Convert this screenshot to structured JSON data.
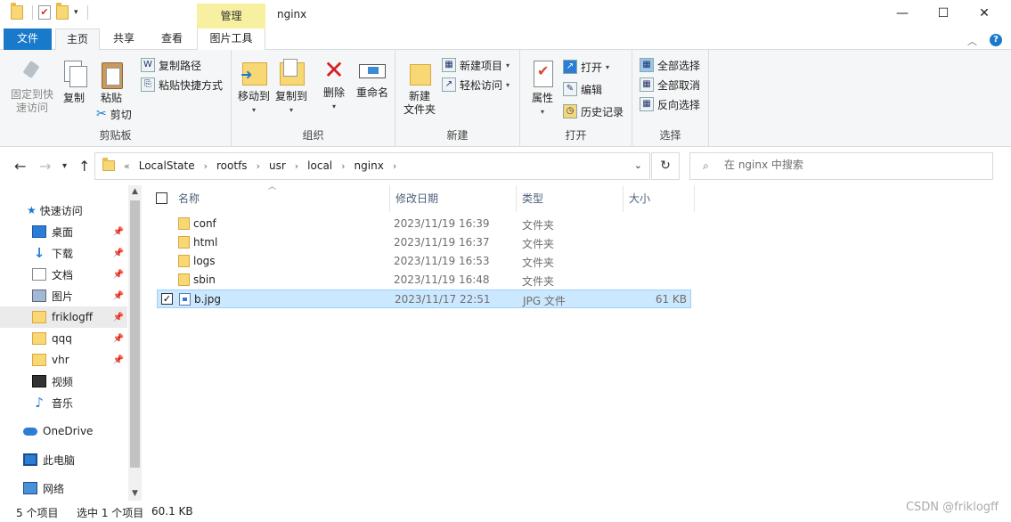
{
  "window": {
    "title": "nginx",
    "context_tab_group": "管理",
    "controls": {
      "minimize": "—",
      "maximize": "☐",
      "close": "✕"
    }
  },
  "ribbon_tabs": {
    "file": "文件",
    "home": "主页",
    "share": "共享",
    "view": "查看",
    "picture_tools": "图片工具"
  },
  "ribbon": {
    "clipboard": {
      "label": "剪贴板",
      "pin_quick_access_1": "固定到快",
      "pin_quick_access_2": "速访问",
      "copy": "复制",
      "paste": "粘贴",
      "copy_path": "复制路径",
      "paste_shortcut": "粘贴快捷方式",
      "cut": "剪切"
    },
    "organize": {
      "label": "组织",
      "move_to": "移动到",
      "copy_to": "复制到",
      "delete": "删除",
      "rename": "重命名"
    },
    "new": {
      "label": "新建",
      "new_folder_1": "新建",
      "new_folder_2": "文件夹",
      "new_item": "新建项目",
      "easy_access": "轻松访问"
    },
    "open": {
      "label": "打开",
      "properties": "属性",
      "open": "打开",
      "edit": "编辑",
      "history": "历史记录"
    },
    "select": {
      "label": "选择",
      "select_all": "全部选择",
      "select_none": "全部取消",
      "invert": "反向选择"
    }
  },
  "address": {
    "overflow": "«",
    "crumbs": [
      "LocalState",
      "rootfs",
      "usr",
      "local",
      "nginx"
    ],
    "separator": "›"
  },
  "search": {
    "placeholder": "在 nginx 中搜索"
  },
  "nav": {
    "quick_access": "快速访问",
    "items": [
      {
        "label": "桌面",
        "icon": "desktop-icon",
        "pinned": true
      },
      {
        "label": "下载",
        "icon": "download-icon",
        "pinned": true
      },
      {
        "label": "文档",
        "icon": "document-icon",
        "pinned": true
      },
      {
        "label": "图片",
        "icon": "picture-icon",
        "pinned": true
      },
      {
        "label": "friklogff",
        "icon": "folder-icon",
        "pinned": true,
        "selected": true
      },
      {
        "label": "qqq",
        "icon": "folder-icon",
        "pinned": true
      },
      {
        "label": "vhr",
        "icon": "folder-icon",
        "pinned": true
      },
      {
        "label": "视频",
        "icon": "video-icon",
        "pinned": false
      },
      {
        "label": "音乐",
        "icon": "music-icon",
        "pinned": false
      }
    ],
    "onedrive": "OneDrive",
    "this_pc": "此电脑",
    "network": "网络"
  },
  "columns": {
    "name": "名称",
    "date": "修改日期",
    "type": "类型",
    "size": "大小"
  },
  "files": [
    {
      "name": "conf",
      "date": "2023/11/19 16:39",
      "type": "文件夹",
      "size": "",
      "kind": "folder"
    },
    {
      "name": "html",
      "date": "2023/11/19 16:37",
      "type": "文件夹",
      "size": "",
      "kind": "folder"
    },
    {
      "name": "logs",
      "date": "2023/11/19 16:53",
      "type": "文件夹",
      "size": "",
      "kind": "folder"
    },
    {
      "name": "sbin",
      "date": "2023/11/19 16:48",
      "type": "文件夹",
      "size": "",
      "kind": "folder"
    },
    {
      "name": "b.jpg",
      "date": "2023/11/17 22:51",
      "type": "JPG 文件",
      "size": "61 KB",
      "kind": "jpg",
      "selected": true
    }
  ],
  "status": {
    "item_count": "5 个项目",
    "selection": "选中 1 个项目",
    "selection_size": "60.1 KB"
  },
  "watermark": "CSDN @friklogff"
}
